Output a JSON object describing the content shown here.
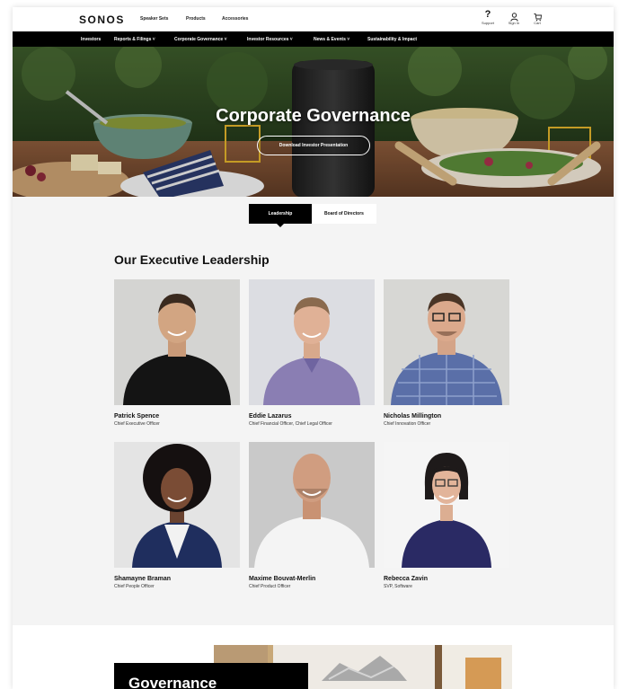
{
  "brand": {
    "logo": "SONOS"
  },
  "topnav": {
    "links": [
      "Speaker Sets",
      "Products",
      "Accessories"
    ],
    "utilities": [
      {
        "label": "Support",
        "icon": "question-icon"
      },
      {
        "label": "Sign In",
        "icon": "user-icon"
      },
      {
        "label": "Cart",
        "icon": "cart-icon"
      }
    ]
  },
  "subnav": {
    "items": [
      "Investors",
      "Reports & Filings ˅",
      "Corporate Governance ˅",
      "Investor Resources ˅",
      "News & Events ˅",
      "Sustainability & Impact"
    ]
  },
  "hero": {
    "title": "Corporate Governance",
    "button": "Download Investor Presentation"
  },
  "tabs": {
    "active": "Leadership",
    "inactive": "Board of Directors"
  },
  "section": {
    "title": "Our Executive Leadership"
  },
  "executives": [
    {
      "name": "Patrick Spence",
      "title": "Chief Executive Officer"
    },
    {
      "name": "Eddie Lazarus",
      "title": "Chief Financial Officer, Chief Legal Officer"
    },
    {
      "name": "Nicholas Millington",
      "title": "Chief Innovation Officer"
    },
    {
      "name": "Shamayne Braman",
      "title": "Chief People Officer"
    },
    {
      "name": "Maxime Bouvat-Merlin",
      "title": "Chief Product Officer"
    },
    {
      "name": "Rebecca Zavin",
      "title": "SVP, Software"
    }
  ],
  "governance": {
    "title": "Governance"
  },
  "colors": {
    "black": "#000000",
    "background": "#f4f4f4",
    "white": "#ffffff"
  }
}
